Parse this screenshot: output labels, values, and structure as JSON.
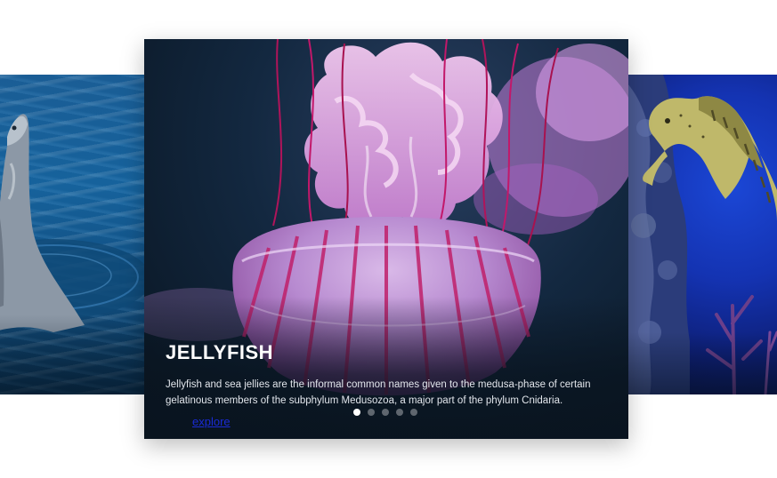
{
  "slides": [
    {
      "name": "dolphin",
      "image": "dolphin-photo"
    },
    {
      "name": "jellyfish",
      "image": "jellyfish-photo",
      "title": "JELLYFISH",
      "description": "Jellyfish and sea jellies are the informal common names given to the medusa-phase of certain gelatinous members of the subphylum Medusozoa, a major part of the phylum Cnidaria.",
      "link_label": "explore"
    },
    {
      "name": "seahorse",
      "image": "seahorse-photo"
    }
  ],
  "pagination": {
    "count": 5,
    "active_index": 0
  },
  "colors": {
    "background": "#ffffff",
    "title": "#ffffff",
    "link": "#1a2bd6",
    "dot_active": "#ffffff",
    "dot_inactive": "rgba(255,255,255,0.35)"
  }
}
